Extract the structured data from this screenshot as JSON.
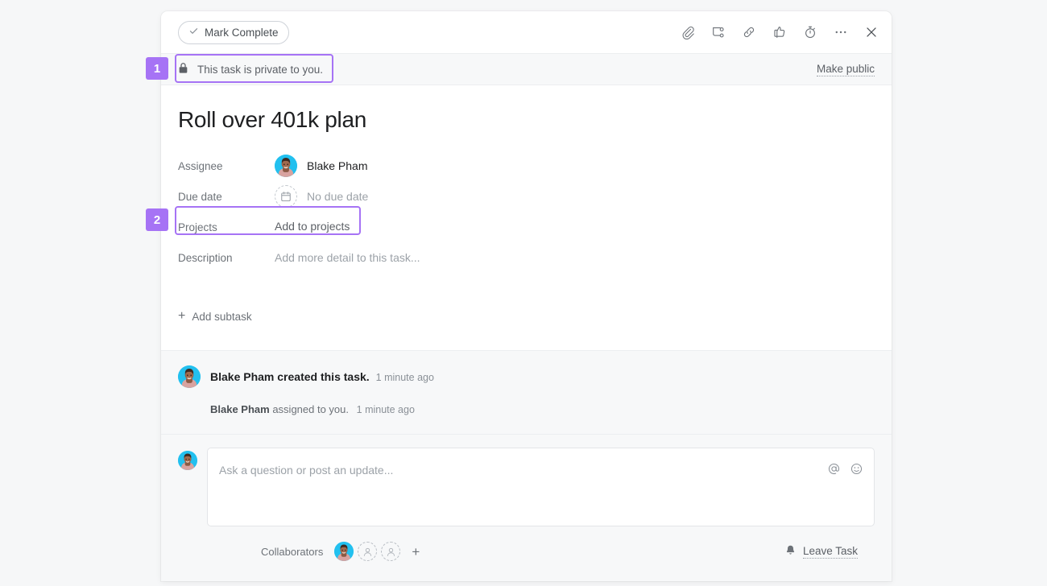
{
  "toolbar": {
    "mark_complete_label": "Mark Complete",
    "icons": [
      {
        "name": "attachment-icon",
        "title": "Attach file"
      },
      {
        "name": "subtask-icon",
        "title": "Add subtask"
      },
      {
        "name": "link-icon",
        "title": "Copy task link"
      },
      {
        "name": "thumbs-up-icon",
        "title": "Like"
      },
      {
        "name": "timer-icon",
        "title": "Start timer"
      },
      {
        "name": "more-options-icon",
        "title": "More actions"
      },
      {
        "name": "close-icon",
        "title": "Close details"
      }
    ]
  },
  "privacy": {
    "message": "This task is private to you.",
    "lock_icon": "lock-icon",
    "make_public_label": "Make public"
  },
  "task": {
    "title": "Roll over 401k plan",
    "fields": {
      "assignee_label": "Assignee",
      "assignee_value": "Blake Pham",
      "due_date_label": "Due date",
      "due_date_value": "No due date",
      "projects_label": "Projects",
      "projects_value": "Add to projects",
      "description_label": "Description",
      "description_placeholder": "Add more detail to this task..."
    },
    "add_subtask_label": "Add subtask"
  },
  "activity": {
    "primary": {
      "actor": "Blake Pham",
      "action": "created this task.",
      "timestamp": "1 minute ago"
    },
    "secondary": {
      "actor": "Blake Pham",
      "action": "assigned to you.",
      "timestamp": "1 minute ago"
    }
  },
  "composer": {
    "placeholder": "Ask a question or post an update...",
    "mention_icon": "mention-icon",
    "emoji_icon": "emoji-icon"
  },
  "footer": {
    "collaborators_label": "Collaborators",
    "add_collaborator_label": "+",
    "leave_task_label": "Leave Task",
    "bell_icon": "bell-icon"
  },
  "annotations": [
    {
      "number": "1",
      "target": "privacy-banner"
    },
    {
      "number": "2",
      "target": "projects-field"
    }
  ],
  "colors": {
    "annotation_purple": "#a673f5",
    "avatar_background": "#22c0ef",
    "panel_background": "#ffffff",
    "page_background": "#f6f7f8"
  }
}
